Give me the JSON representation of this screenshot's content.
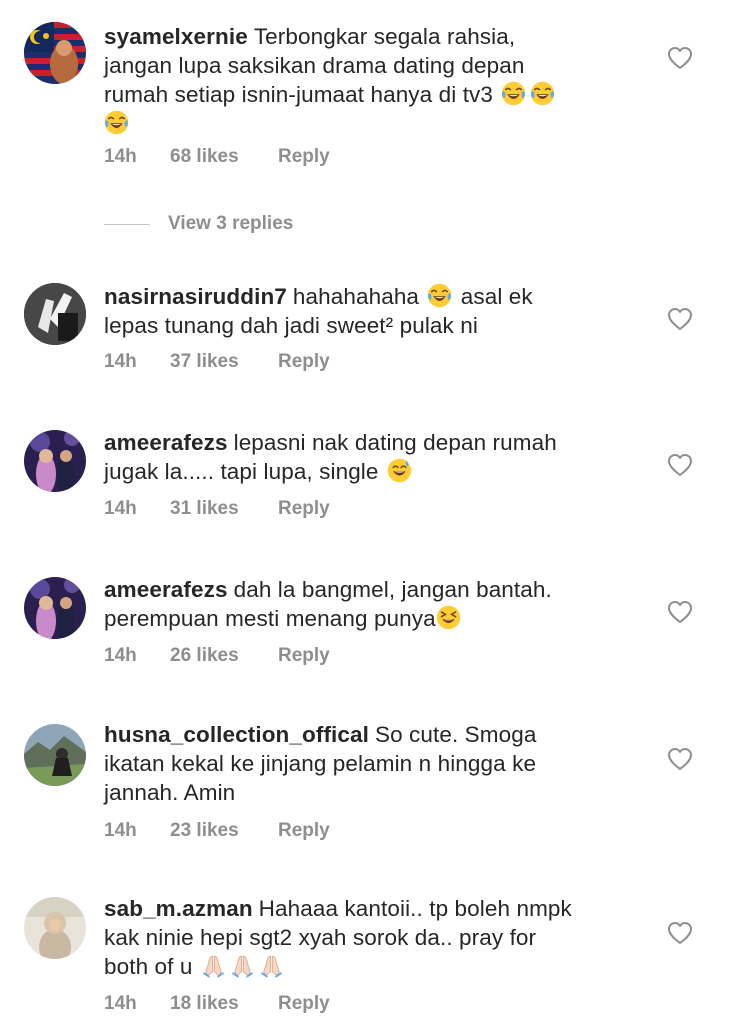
{
  "comments": [
    {
      "username": "syamelxernie",
      "lines": [
        "Terbongkar segala rahsia,",
        "jangan lupa saksikan drama dating depan",
        "rumah setiap isnin-jumaat hanya di tv3"
      ],
      "emojis": [
        "face-with-tears-of-joy",
        "face-with-tears-of-joy",
        "face-with-tears-of-joy"
      ],
      "time": "14h",
      "likes": "68 likes",
      "reply": "Reply"
    },
    {
      "username": "nasirnasiruddin7",
      "text_before_emoji": "hahahahaha",
      "text_after_emoji": "asal ek",
      "line2": "lepas tunang dah jadi sweet² pulak ni",
      "emoji": "face-with-tears-of-joy",
      "time": "14h",
      "likes": "37 likes",
      "reply": "Reply"
    },
    {
      "username": "ameerafezs",
      "line1": "lepasni nak dating depan rumah",
      "line2": "jugak la..... tapi lupa, single",
      "emoji": "grinning-face-with-sweat",
      "time": "14h",
      "likes": "31 likes",
      "reply": "Reply"
    },
    {
      "username": "ameerafezs",
      "line1": "dah la bangmel, jangan bantah.",
      "line2": "perempuan mesti menang punya",
      "emoji": "grinning-squinting-face",
      "time": "14h",
      "likes": "26 likes",
      "reply": "Reply"
    },
    {
      "username": "husna_collection_offical",
      "line1": "So cute. Smoga",
      "line2": "ikatan kekal ke jinjang pelamin n hingga ke",
      "line3": "jannah. Amin",
      "time": "14h",
      "likes": "23 likes",
      "reply": "Reply"
    },
    {
      "username": "sab_m.azman",
      "line1": "Hahaaa kantoii.. tp boleh nmpk",
      "line2": "kak ninie hepi sgt2 xyah sorok da.. pray for",
      "line3": "both of u",
      "emojis": [
        "folded-hands",
        "folded-hands",
        "folded-hands"
      ],
      "time": "14h",
      "likes": "18 likes",
      "reply": "Reply"
    }
  ],
  "view_replies": "View 3 replies",
  "icons": {
    "like": "heart-outline-icon"
  },
  "colors": {
    "text": "#262626",
    "secondary": "#8e8e8e",
    "divider": "#c7c7c7",
    "background": "#ffffff"
  }
}
